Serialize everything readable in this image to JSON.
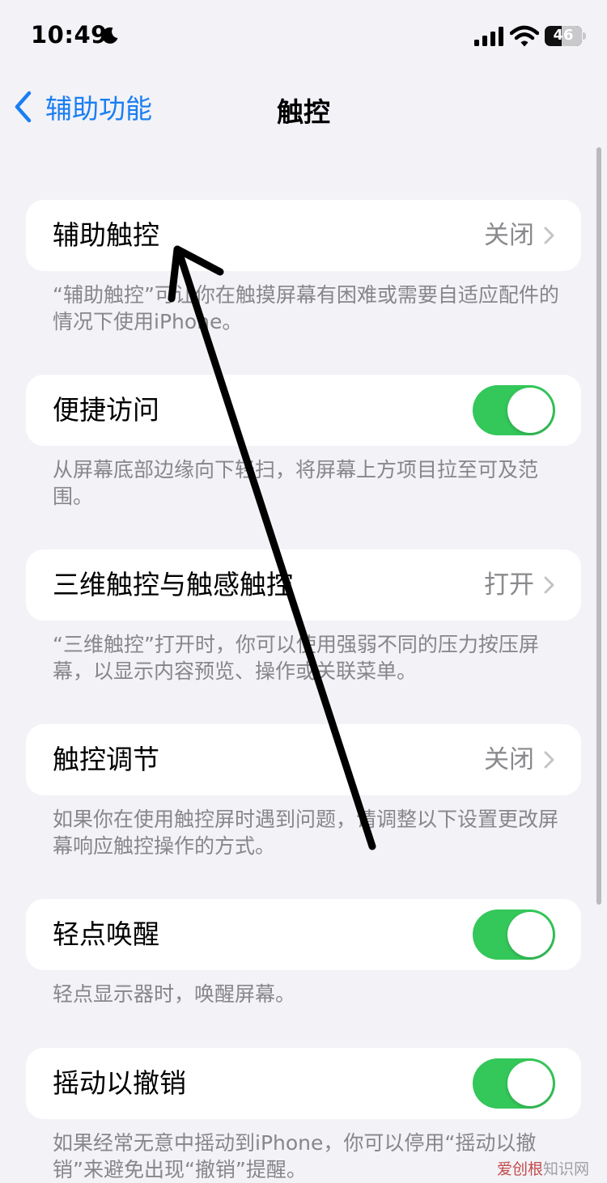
{
  "status": {
    "time": "10:49",
    "battery": "46"
  },
  "nav": {
    "back_label": "辅助功能",
    "title": "触控"
  },
  "rows": [
    {
      "label": "辅助触控",
      "value": "关闭",
      "desc": "“辅助触控”可让你在触摸屏幕有困难或需要自适应配件的情况下使用iPhone。"
    },
    {
      "label": "便捷访问",
      "toggle": "on",
      "desc": "从屏幕底部边缘向下轻扫，将屏幕上方项目拉至可及范围。"
    },
    {
      "label": "三维触控与触感触控",
      "value": "打开",
      "desc": "“三维触控”打开时，你可以使用强弱不同的压力按压屏幕，以显示内容预览、操作或关联菜单。"
    },
    {
      "label": "触控调节",
      "value": "关闭",
      "desc": "如果你在使用触控屏时遇到问题，请调整以下设置更改屏幕响应触控操作的方式。"
    },
    {
      "label": "轻点唤醒",
      "toggle": "on",
      "desc": "轻点显示器时，唤醒屏幕。"
    },
    {
      "label": "摇动以撤销",
      "toggle": "on",
      "desc": "如果经常无意中摇动到iPhone，你可以停用“摇动以撤销”来避免出现“撤销”提醒。"
    }
  ],
  "watermark": {
    "brand": "爱创根",
    "suffix": "知识网"
  },
  "colors": {
    "accent": "#1a7ef2",
    "toggle_on": "#34c759",
    "background": "#f2f2f7",
    "annotation_arrow": "#000000"
  },
  "icons": [
    "moon-icon",
    "cellular-signal-icon",
    "wifi-icon",
    "battery-icon",
    "chevron-left-icon",
    "chevron-right-icon",
    "annotation-arrow"
  ]
}
